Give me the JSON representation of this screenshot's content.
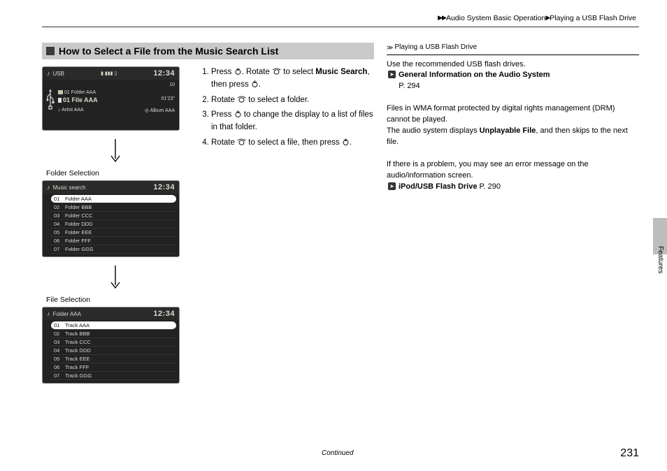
{
  "breadcrumb": {
    "seg1": "Audio System Basic Operation",
    "seg2": "Playing a USB Flash Drive"
  },
  "section_title": "How to Select a File from the Music Search List",
  "instructions": {
    "i1a": "Press ",
    "i1b": ". Rotate ",
    "i1c": " to select ",
    "i1d": "Music Search",
    "i1e": ", then press ",
    "i1f": ".",
    "i2a": "Rotate ",
    "i2b": " to select a folder.",
    "i3a": "Press ",
    "i3b": " to change the display to a list of files in that folder.",
    "i4a": "Rotate ",
    "i4b": " to select a file, then press ",
    "i4c": "."
  },
  "screen1": {
    "source": "USB",
    "time": "12:34",
    "track_no": "10",
    "folder": "01 Folder AAA",
    "file": "01 File AAA",
    "duration": "01'23\"",
    "artist": "Artist AAA",
    "album": "Album AAA"
  },
  "caption_folder": "Folder Selection",
  "screen2": {
    "title": "Music search",
    "time": "12:34",
    "rows": [
      {
        "n": "01",
        "t": "Folder AAA"
      },
      {
        "n": "02",
        "t": "Folder BBB"
      },
      {
        "n": "03",
        "t": "Folder CCC"
      },
      {
        "n": "04",
        "t": "Folder DDD"
      },
      {
        "n": "05",
        "t": "Folder EEE"
      },
      {
        "n": "06",
        "t": "Folder FFF"
      },
      {
        "n": "07",
        "t": "Folder GGG"
      }
    ]
  },
  "caption_file": "File Selection",
  "screen3": {
    "title": "Folder AAA",
    "time": "12:34",
    "rows": [
      {
        "n": "01",
        "t": "Track AAA"
      },
      {
        "n": "02",
        "t": "Track BBB"
      },
      {
        "n": "03",
        "t": "Track CCC"
      },
      {
        "n": "04",
        "t": "Track DDD"
      },
      {
        "n": "05",
        "t": "Track EEE"
      },
      {
        "n": "06",
        "t": "Track FFF"
      },
      {
        "n": "07",
        "t": "Track GGG"
      }
    ]
  },
  "right": {
    "head": "Playing a USB Flash Drive",
    "p1": "Use the recommended USB flash drives.",
    "ref1_title": "General Information on the Audio System",
    "ref1_page": "P. 294",
    "p2a": "Files in WMA format protected by digital rights management (DRM) cannot be played.",
    "p2b1": "The audio system displays ",
    "p2b_bold": "Unplayable File",
    "p2b2": ", and then skips to the next file.",
    "p3": "If there is a problem, you may see an error message on the audio/information screen.",
    "ref2_title": "iPod/USB Flash Drive",
    "ref2_page": "P. 290"
  },
  "side_tab": "Features",
  "continued": "Continued",
  "page_number": "231"
}
